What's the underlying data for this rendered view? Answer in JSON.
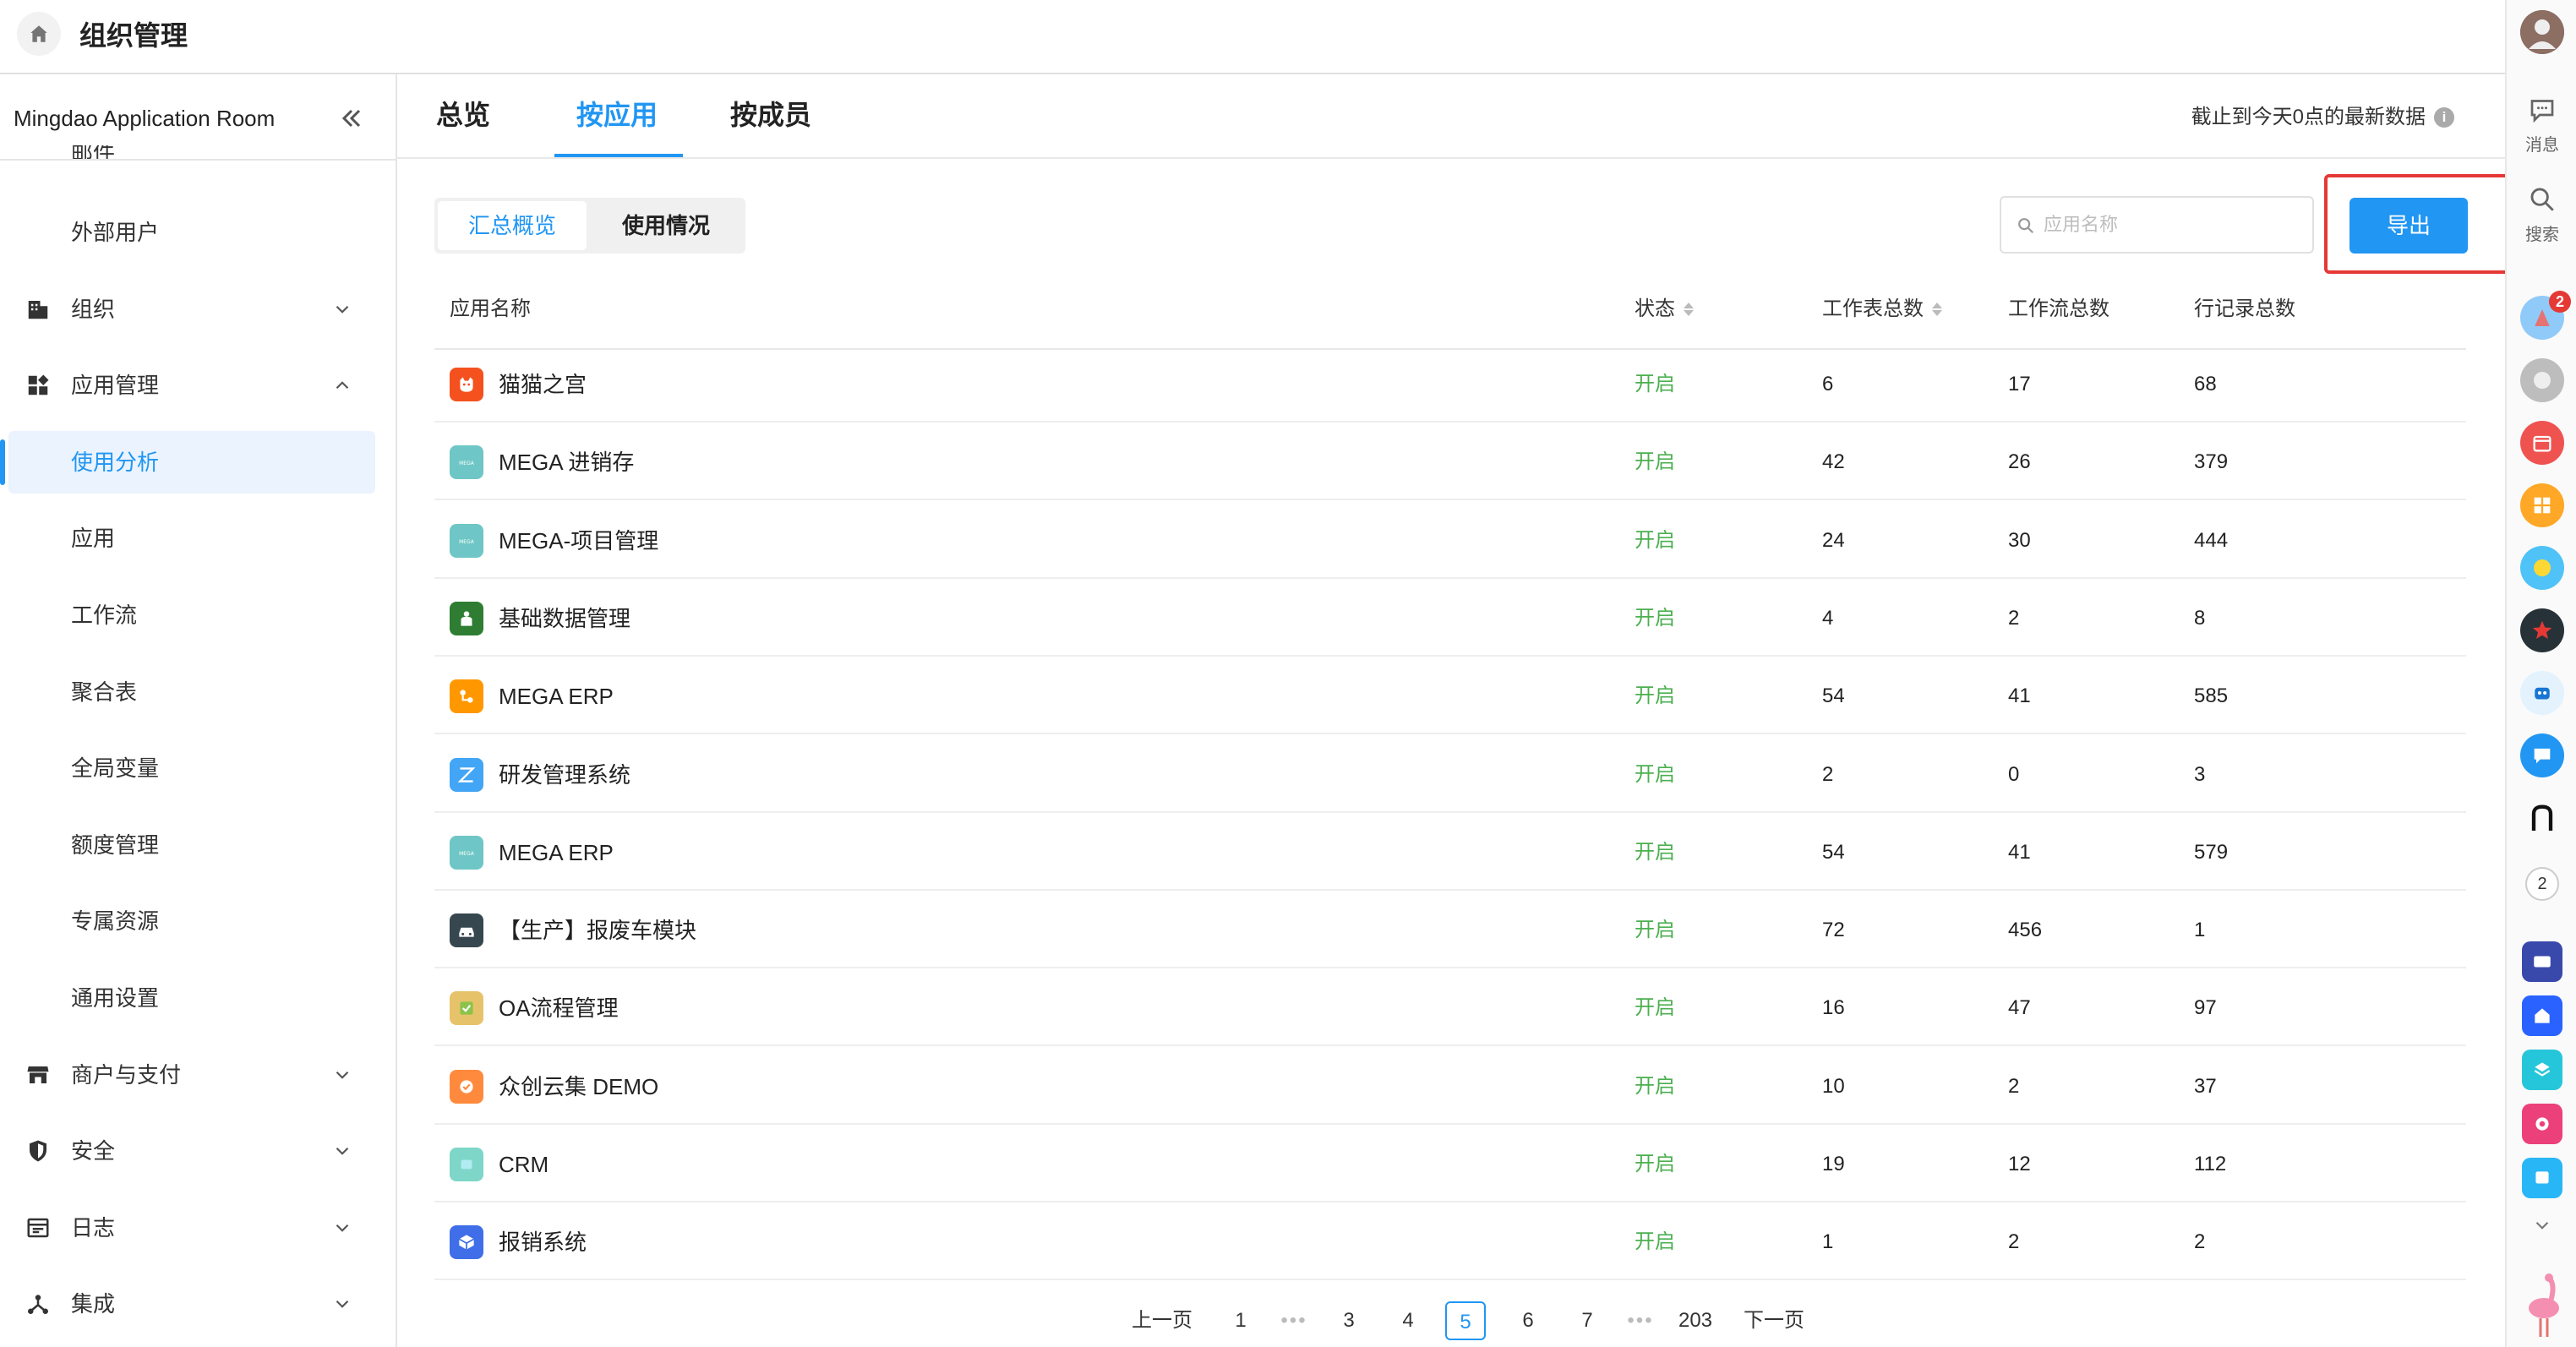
{
  "header": {
    "title": "组织管理"
  },
  "sidebar": {
    "org_name": "Mingdao Application Room",
    "cut_item": "邮件",
    "items": [
      {
        "label": "外部用户",
        "kind": "sub"
      },
      {
        "label": "组织",
        "kind": "group",
        "icon": "building-icon",
        "expanded": false
      },
      {
        "label": "应用管理",
        "kind": "group",
        "icon": "apps-icon",
        "expanded": true
      },
      {
        "label": "使用分析",
        "kind": "sub",
        "active": true
      },
      {
        "label": "应用",
        "kind": "sub"
      },
      {
        "label": "工作流",
        "kind": "sub"
      },
      {
        "label": "聚合表",
        "kind": "sub"
      },
      {
        "label": "全局变量",
        "kind": "sub"
      },
      {
        "label": "额度管理",
        "kind": "sub"
      },
      {
        "label": "专属资源",
        "kind": "sub"
      },
      {
        "label": "通用设置",
        "kind": "sub"
      },
      {
        "label": "商户与支付",
        "kind": "group",
        "icon": "store-icon",
        "expanded": false
      },
      {
        "label": "安全",
        "kind": "group",
        "icon": "shield-icon",
        "expanded": false
      },
      {
        "label": "日志",
        "kind": "group",
        "icon": "log-icon",
        "expanded": false
      },
      {
        "label": "集成",
        "kind": "group",
        "icon": "integration-icon",
        "expanded": false
      }
    ]
  },
  "tabs": [
    {
      "label": "总览"
    },
    {
      "label": "按应用",
      "active": true
    },
    {
      "label": "按成员"
    }
  ],
  "data_note": "截止到今天0点的最新数据",
  "segment": {
    "on": "汇总概览",
    "off": "使用情况"
  },
  "search": {
    "placeholder": "应用名称",
    "value": ""
  },
  "export_label": "导出",
  "colors": {
    "accent": "#2196f3",
    "status_on": "#4caf50",
    "highlight": "#e53935"
  },
  "table": {
    "headers": [
      "应用名称",
      "状态",
      "工作表总数",
      "工作流总数",
      "行记录总数"
    ],
    "rows": [
      {
        "name": "猫猫之宫",
        "status": "开启",
        "sheets": "6",
        "flows": "17",
        "records": "68",
        "icon_color": "#f4511e",
        "icon": "cat-icon"
      },
      {
        "name": "MEGA 进销存",
        "status": "开启",
        "sheets": "42",
        "flows": "26",
        "records": "379",
        "icon_color": "#6ec6c6",
        "icon": "mega-icon"
      },
      {
        "name": "MEGA-项目管理",
        "status": "开启",
        "sheets": "24",
        "flows": "30",
        "records": "444",
        "icon_color": "#6ec6c6",
        "icon": "mega-icon"
      },
      {
        "name": "基础数据管理",
        "status": "开启",
        "sheets": "4",
        "flows": "2",
        "records": "8",
        "icon_color": "#2e7d32",
        "icon": "people-icon"
      },
      {
        "name": "MEGA ERP",
        "status": "开启",
        "sheets": "54",
        "flows": "41",
        "records": "585",
        "icon_color": "#ff9800",
        "icon": "erp-icon"
      },
      {
        "name": "研发管理系统",
        "status": "开启",
        "sheets": "2",
        "flows": "0",
        "records": "3",
        "icon_color": "#42a5f5",
        "icon": "rd-icon"
      },
      {
        "name": "MEGA ERP",
        "status": "开启",
        "sheets": "54",
        "flows": "41",
        "records": "579",
        "icon_color": "#6ec6c6",
        "icon": "mega-icon"
      },
      {
        "name": "【生产】报废车模块",
        "status": "开启",
        "sheets": "72",
        "flows": "456",
        "records": "1",
        "icon_color": "#37474f",
        "icon": "car-icon"
      },
      {
        "name": "OA流程管理",
        "status": "开启",
        "sheets": "16",
        "flows": "47",
        "records": "97",
        "icon_color": "#e6c36b",
        "icon": "oa-icon"
      },
      {
        "name": "众创云集 DEMO",
        "status": "开启",
        "sheets": "10",
        "flows": "2",
        "records": "37",
        "icon_color": "#ff8a3d",
        "icon": "check-icon"
      },
      {
        "name": "CRM",
        "status": "开启",
        "sheets": "19",
        "flows": "12",
        "records": "112",
        "icon_color": "#7ed6c8",
        "icon": "crm-icon"
      },
      {
        "name": "报销系统",
        "status": "开启",
        "sheets": "1",
        "flows": "2",
        "records": "2",
        "icon_color": "#3f6ee8",
        "icon": "box-icon"
      }
    ]
  },
  "pagination": {
    "prev": "上一页",
    "next": "下一页",
    "pages": [
      "1",
      "•••",
      "3",
      "4",
      "5",
      "6",
      "7",
      "•••",
      "203"
    ],
    "current": "5"
  },
  "rail": {
    "message_label": "消息",
    "search_label": "搜索",
    "badge": "2",
    "count": "2"
  }
}
